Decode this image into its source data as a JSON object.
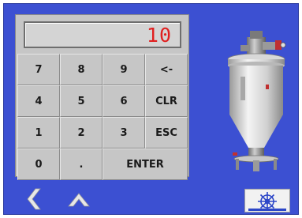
{
  "display": {
    "value": "10"
  },
  "keys": {
    "k7": "7",
    "k8": "8",
    "k9": "9",
    "back": "<-",
    "k4": "4",
    "k5": "5",
    "k6": "6",
    "clr": "CLR",
    "k1": "1",
    "k2": "2",
    "k3": "3",
    "esc": "ESC",
    "k0": "0",
    "dot": ".",
    "enter": "ENTER"
  },
  "colors": {
    "background": "#3c50d2",
    "keypad": "#c6c6c6",
    "display_text": "#e02020"
  },
  "icons": {
    "back": "chevron-left-icon",
    "up": "chevron-up-icon",
    "home": "ship-wheel-icon",
    "machine": "vacuum-hopper-illustration"
  }
}
